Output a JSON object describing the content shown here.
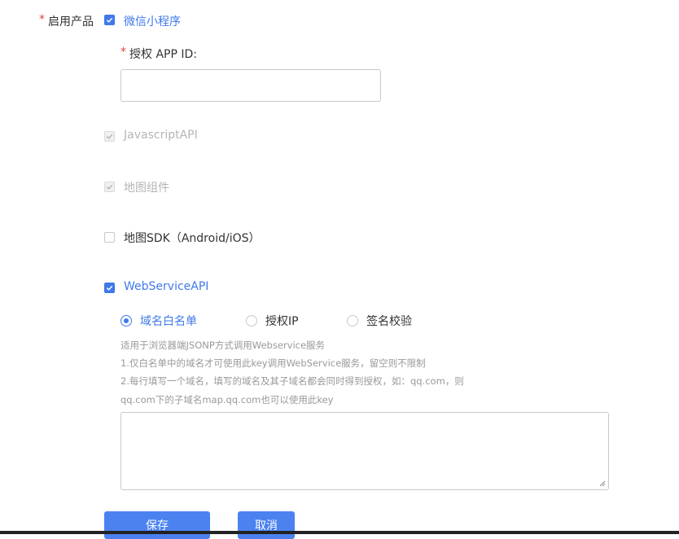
{
  "form": {
    "enable_products": {
      "required_mark": "*",
      "label": "启用产品"
    },
    "products": [
      {
        "key": "mini_program",
        "label": "微信小程序",
        "checked": true,
        "disabled": false
      },
      {
        "key": "javascript_api",
        "label": "JavascriptAPI",
        "checked": true,
        "disabled": true
      },
      {
        "key": "map_component",
        "label": "地图组件",
        "checked": true,
        "disabled": true
      },
      {
        "key": "map_sdk",
        "label": "地图SDK（Android/iOS）",
        "checked": false,
        "disabled": false
      },
      {
        "key": "webservice_api",
        "label": "WebServiceAPI",
        "checked": true,
        "disabled": false
      }
    ],
    "app_id": {
      "required_mark": "*",
      "label": "授权 APP ID:",
      "value": "",
      "placeholder": ""
    },
    "auth_modes": {
      "selected": "域名白名单",
      "options": [
        "域名白名单",
        "授权IP",
        "签名校验"
      ]
    },
    "help_text": [
      "适用于浏览器端JSONP方式调用Webservice服务",
      "1.仅白名单中的域名才可使用此key调用WebService服务，留空则不限制",
      "2.每行填写一个域名，填写的域名及其子域名都会同时得到授权，如：qq.com，则",
      "qq.com下的子域名map.qq.com也可以使用此key"
    ],
    "whitelist": {
      "value": ""
    },
    "buttons": {
      "save": "保存",
      "cancel": "取消"
    }
  },
  "colors": {
    "accent": "#3f79ea",
    "required": "#e0443a",
    "button": "#4b82f0"
  }
}
